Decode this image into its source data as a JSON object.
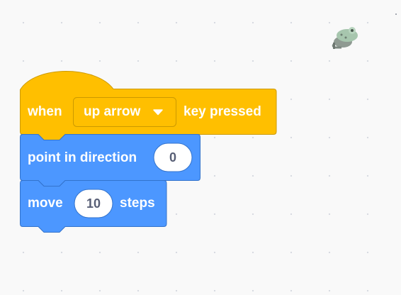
{
  "colors": {
    "canvas_background": "#f9f9f9",
    "events_block": "#ffbf00",
    "events_block_border": "#cc9900",
    "motion_block": "#4c97ff",
    "motion_block_border": "#3373cc",
    "text_on_block": "#ffffff",
    "input_text": "#575e75"
  },
  "sprite": {
    "icon": "frog-sprite-icon"
  },
  "script": {
    "hat_block": {
      "category": "events",
      "prefix": "when",
      "key_dropdown": {
        "selected": "up arrow",
        "icon": "caret-down-icon"
      },
      "suffix": "key pressed"
    },
    "point_block": {
      "category": "motion",
      "label": "point in direction",
      "direction_value": "0"
    },
    "move_block": {
      "category": "motion",
      "prefix": "move",
      "steps_value": "10",
      "suffix": "steps"
    }
  }
}
